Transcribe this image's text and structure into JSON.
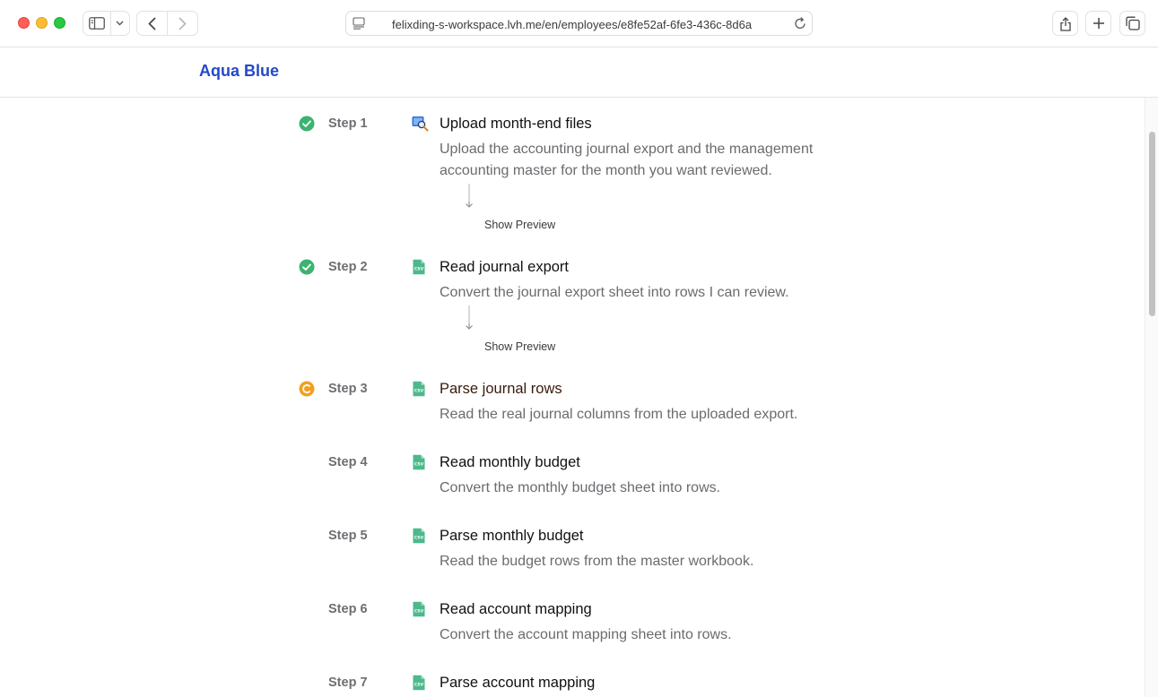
{
  "browser": {
    "url": "felixding-s-workspace.lvh.me/en/employees/e8fe52af-6fe3-436c-8d6a"
  },
  "app": {
    "brand": "Aqua Blue"
  },
  "colors": {
    "brand": "#2448c8",
    "done": "#3cb371",
    "in_progress": "#f0a020",
    "csv_icon": "#4cb98c"
  },
  "steps": [
    {
      "label": "Step 1",
      "title": "Upload month-end files",
      "description": "Upload the accounting journal export and the management accounting master for the month you want reviewed.",
      "status": "done",
      "icon": "upload-search-icon",
      "preview_label": "Show Preview"
    },
    {
      "label": "Step 2",
      "title": "Read journal export",
      "description": "Convert the journal export sheet into rows I can review.",
      "status": "done",
      "icon": "csv-file-icon",
      "preview_label": "Show Preview"
    },
    {
      "label": "Step 3",
      "title": "Parse journal rows",
      "description": "Read the real journal columns from the uploaded export.",
      "status": "in_progress",
      "icon": "csv-file-icon"
    },
    {
      "label": "Step 4",
      "title": "Read monthly budget",
      "description": "Convert the monthly budget sheet into rows.",
      "status": "pending",
      "icon": "csv-file-icon"
    },
    {
      "label": "Step 5",
      "title": "Parse monthly budget",
      "description": "Read the budget rows from the master workbook.",
      "status": "pending",
      "icon": "csv-file-icon"
    },
    {
      "label": "Step 6",
      "title": "Read account mapping",
      "description": "Convert the account mapping sheet into rows.",
      "status": "pending",
      "icon": "csv-file-icon"
    },
    {
      "label": "Step 7",
      "title": "Parse account mapping",
      "description": "",
      "status": "pending",
      "icon": "csv-file-icon"
    }
  ]
}
